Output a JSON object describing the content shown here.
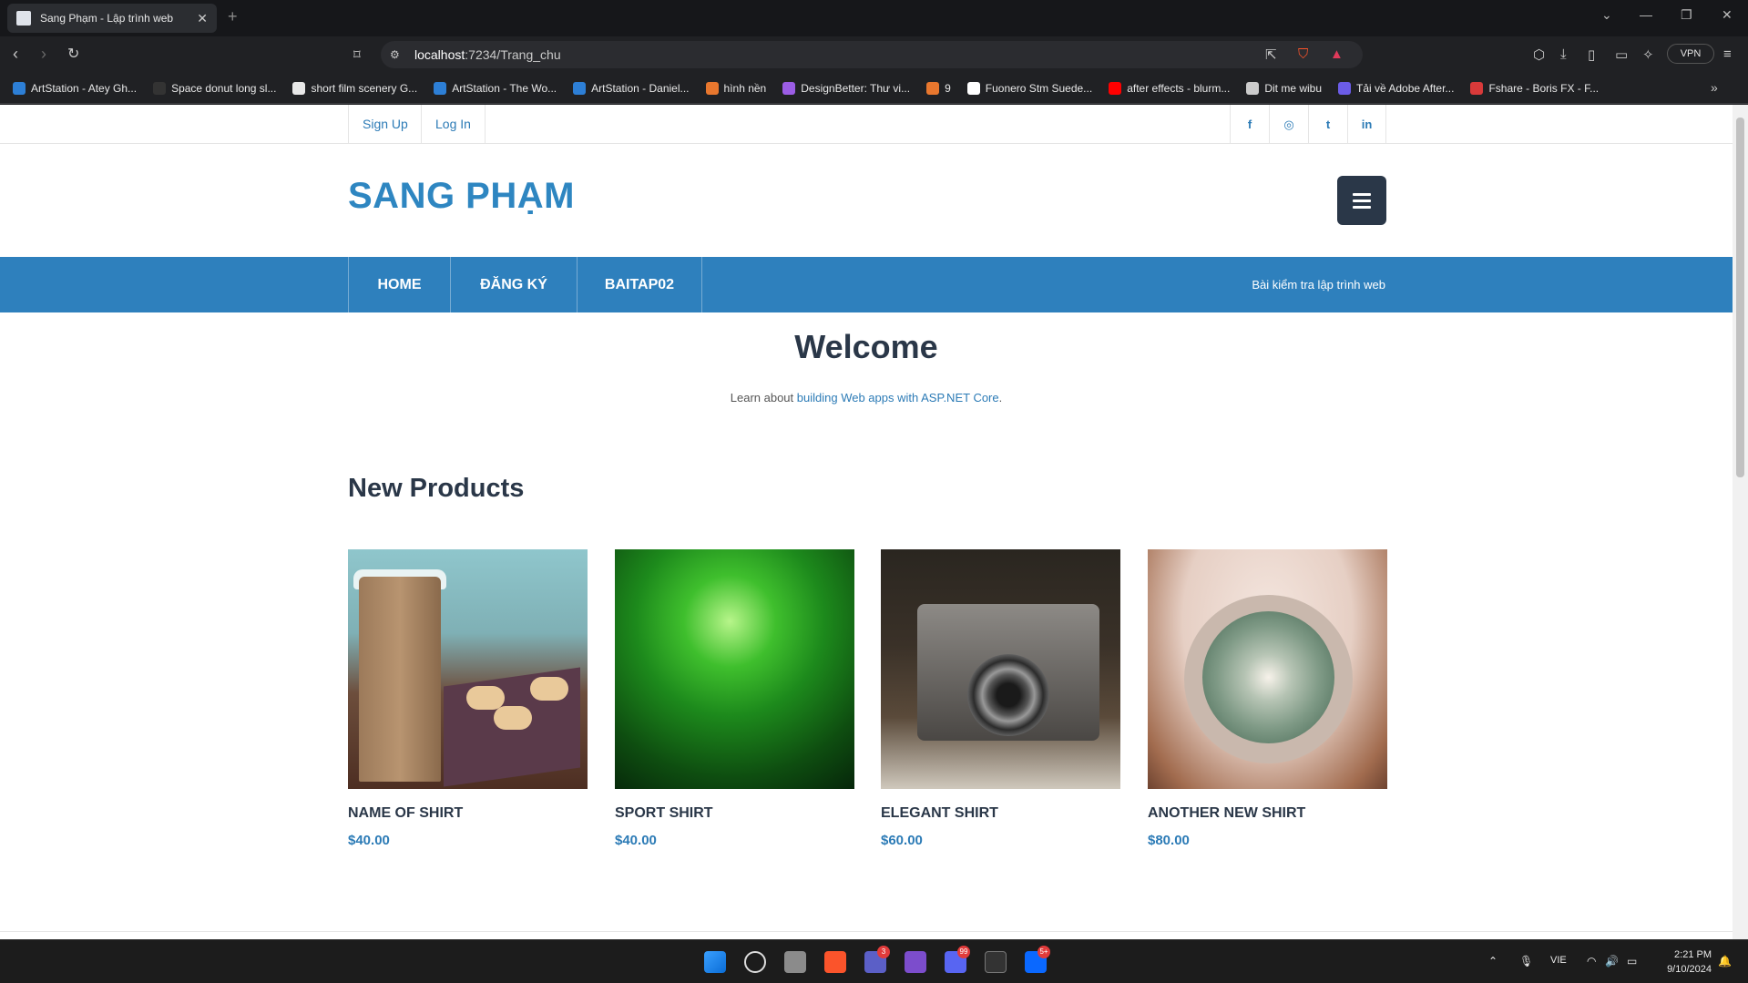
{
  "browser": {
    "tab_title": "Sang Phạm - Lập trình web",
    "tab_close": "✕",
    "new_tab": "+",
    "url_host": "localhost",
    "url_rest": ":7234/Trang_chu",
    "vpn_label": "VPN",
    "bookmarks": [
      {
        "label": "ArtStation - Atey Gh...",
        "color": "#2d7fd6"
      },
      {
        "label": "Space donut long sl...",
        "color": "#333333"
      },
      {
        "label": "short film scenery G...",
        "color": "#e8e8e8"
      },
      {
        "label": "ArtStation - The Wo...",
        "color": "#2d7fd6"
      },
      {
        "label": "ArtStation - Daniel...",
        "color": "#2d7fd6"
      },
      {
        "label": "hình nền",
        "color": "#e8772e"
      },
      {
        "label": "DesignBetter: Thư vi...",
        "color": "#9b5de5"
      },
      {
        "label": "9",
        "color": "#e8772e"
      },
      {
        "label": "Fuonero Stm Suede...",
        "color": "#ffffff"
      },
      {
        "label": "after effects - blurm...",
        "color": "#ff0000"
      },
      {
        "label": "Dit me wibu",
        "color": "#cccccc"
      },
      {
        "label": "Tải về Adobe After...",
        "color": "#6b5ce7"
      },
      {
        "label": "Fshare - Boris FX - F...",
        "color": "#d93a3a"
      }
    ]
  },
  "site": {
    "signup": "Sign Up",
    "login": "Log In",
    "social": [
      "f",
      "◎",
      "t",
      "in"
    ],
    "brand": "SANG PHẠM",
    "nav": [
      "HOME",
      "ĐĂNG KÝ",
      "BAITAP02"
    ],
    "nav_right": "Bài kiểm tra lập trình web",
    "welcome": "Welcome",
    "learn_prefix": "Learn about ",
    "learn_link": "building Web apps with ASP.NET Core",
    "learn_suffix": ".",
    "section_title": "New Products",
    "products": [
      {
        "name": "NAME OF SHIRT",
        "price": "$40.00"
      },
      {
        "name": "SPORT SHIRT",
        "price": "$40.00"
      },
      {
        "name": "ELEGANT SHIRT",
        "price": "$60.00"
      },
      {
        "name": "ANOTHER NEW SHIRT",
        "price": "$80.00"
      }
    ]
  },
  "taskbar": {
    "teams_badge": "3",
    "discord_badge": "99",
    "zalo_badge": "5+",
    "lang": "VIE",
    "time": "2:21 PM",
    "date": "9/10/2024"
  }
}
